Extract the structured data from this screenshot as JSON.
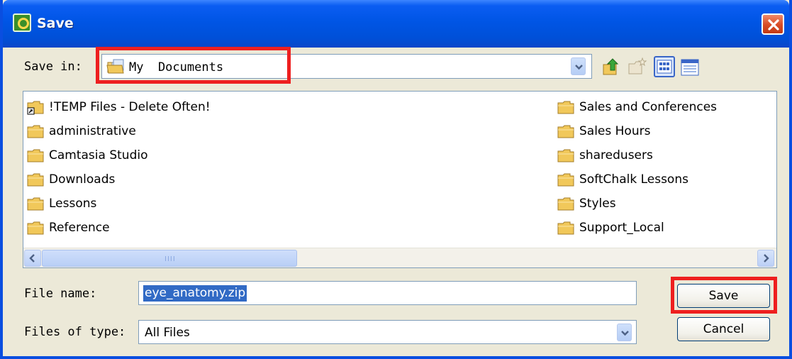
{
  "window": {
    "title": "Save",
    "close_icon": "close-icon"
  },
  "toolbar": {
    "save_in_label": "Save in:",
    "save_in_value": "My  Documents",
    "icons": [
      "up-folder-icon",
      "new-folder-icon",
      "view-list-icon",
      "view-details-icon"
    ]
  },
  "files": {
    "left": [
      {
        "label": "!TEMP Files - Delete Often!",
        "icon": "shortcut-folder-icon"
      },
      {
        "label": "administrative",
        "icon": "folder-icon"
      },
      {
        "label": "Camtasia Studio",
        "icon": "folder-icon"
      },
      {
        "label": "Downloads",
        "icon": "folder-icon"
      },
      {
        "label": "Lessons",
        "icon": "folder-icon"
      },
      {
        "label": "Reference",
        "icon": "folder-icon"
      }
    ],
    "right": [
      {
        "label": "Sales and Conferences",
        "icon": "folder-icon"
      },
      {
        "label": "Sales Hours",
        "icon": "folder-icon"
      },
      {
        "label": "sharedusers",
        "icon": "folder-icon"
      },
      {
        "label": "SoftChalk Lessons",
        "icon": "folder-icon"
      },
      {
        "label": "Styles",
        "icon": "folder-icon"
      },
      {
        "label": "Support_Local",
        "icon": "folder-icon"
      }
    ]
  },
  "form": {
    "file_name_label": "File name:",
    "file_name_value": "eye_anatomy.zip",
    "file_type_label": "Files of type:",
    "file_type_value": "All Files"
  },
  "buttons": {
    "save": "Save",
    "cancel": "Cancel"
  },
  "colors": {
    "titlebar": "#0055e5",
    "dialog_bg": "#ece9d8",
    "highlight": "#ee1f1f",
    "selection": "#316ac5"
  }
}
